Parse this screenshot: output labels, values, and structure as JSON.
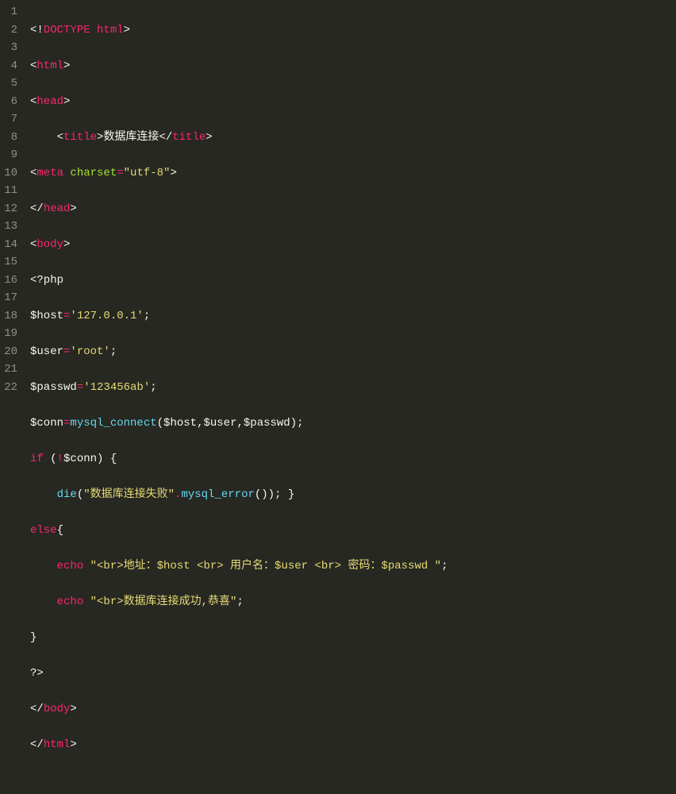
{
  "lines": [
    "1",
    "2",
    "3",
    "4",
    "5",
    "6",
    "7",
    "8",
    "9",
    "10",
    "11",
    "12",
    "13",
    "14",
    "15",
    "16",
    "17",
    "18",
    "19",
    "20",
    "21",
    "22"
  ],
  "code": {
    "l1": {
      "doctype": "DOCTYPE",
      "html": "html"
    },
    "l2": {
      "tag": "html"
    },
    "l3": {
      "tag": "head"
    },
    "l4": {
      "tag": "title",
      "text": "数据库连接",
      "ctag": "title"
    },
    "l5": {
      "tag": "meta",
      "attr": "charset",
      "val": "\"utf-8\""
    },
    "l6": {
      "tag": "head"
    },
    "l7": {
      "tag": "body"
    },
    "l8": {
      "text": "<?php"
    },
    "l9": {
      "var": "$host",
      "val": "'127.0.0.1'"
    },
    "l10": {
      "var": "$user",
      "val": "'root'"
    },
    "l11": {
      "var": "$passwd",
      "val": "'123456ab'"
    },
    "l12": {
      "var": "$conn",
      "func": "mysql_connect",
      "a1": "$host",
      "a2": "$user",
      "a3": "$passwd"
    },
    "l13": {
      "kw": "if",
      "var": "$conn"
    },
    "l14": {
      "func": "die",
      "str": "\"数据库连接失败\"",
      "func2": "mysql_error"
    },
    "l15": {
      "kw": "else"
    },
    "l16": {
      "kw": "echo",
      "str": "\"<br>地址：$host <br> 用户名：$user <br> 密码：$passwd \""
    },
    "l17": {
      "kw": "echo",
      "str": "\"<br>数据库连接成功,恭喜\""
    },
    "l18": {
      "text": "}"
    },
    "l19": {
      "text": "?>"
    },
    "l20": {
      "tag": "body"
    },
    "l21": {
      "tag": "html"
    }
  }
}
